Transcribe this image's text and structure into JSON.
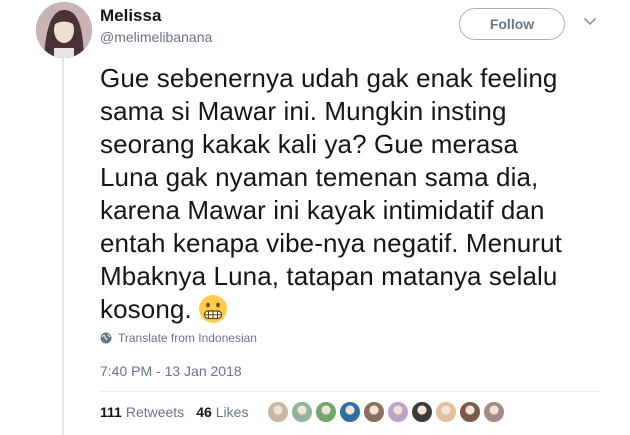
{
  "user": {
    "name": "Melissa",
    "handle": "@melimelibanana"
  },
  "follow_button": {
    "label": "Follow"
  },
  "tweet": {
    "text": "Gue sebenernya udah gak enak feeling\nsama si Mawar ini. Mungkin insting\nseorang kakak kali ya? Gue merasa\nLuna gak nyaman temenan sama dia,\nkarena Mawar ini kayak intimidatif dan\nentah kenapa vibe-nya negatif. Menurut\nMbaknya Luna, tatapan matanya selalu\nkosong.",
    "emoji": "grimacing-face",
    "translate_label": "Translate from Indonesian",
    "timestamp": "7:40 PM - 13 Jan 2018"
  },
  "stats": {
    "retweets_count": "111",
    "retweets_label": "Retweets",
    "likes_count": "46",
    "likes_label": "Likes"
  },
  "likers_colors": [
    "#c9b7a6",
    "#8fb3a0",
    "#6fa86a",
    "#2d6ea3",
    "#8a7060",
    "#b8a4c8",
    "#3c3c3c",
    "#e0c19a",
    "#7a5a4a",
    "#a58a8a"
  ],
  "colors": {
    "text": "#14171a",
    "secondary": "#657786",
    "border": "#e1e8ed"
  }
}
